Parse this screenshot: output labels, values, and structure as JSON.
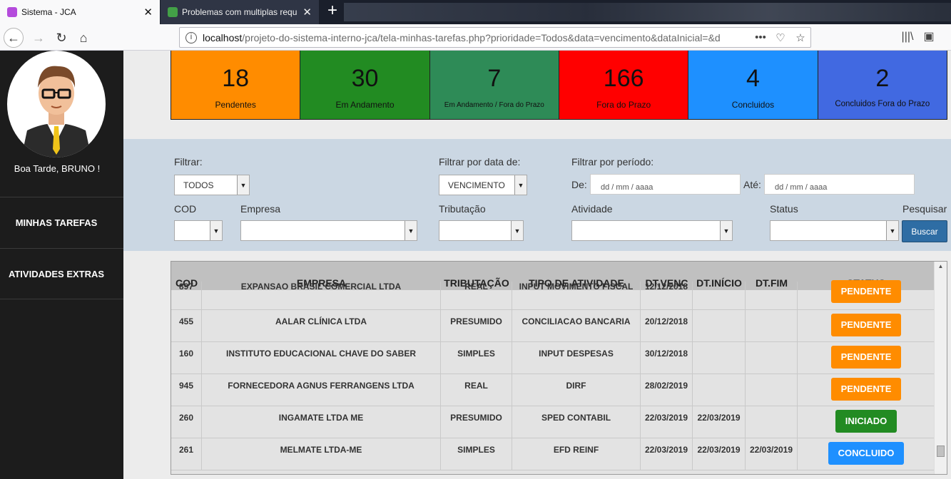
{
  "browser": {
    "tabs": [
      {
        "title": "Sistema - JCA",
        "favicon_color": "#b44bdc"
      },
      {
        "title": "Problemas com multiplas requ",
        "favicon_color": "#43a047"
      }
    ],
    "url_host": "localhost",
    "url_path": "/projeto-do-sistema-interno-jca/tela-minhas-tarefas.php?prioridade=Todos&data=vencimento&dataInicial=&d"
  },
  "sidebar": {
    "greeting": "Boa Tarde, BRUNO !",
    "items": [
      {
        "label": "MINHAS TAREFAS"
      },
      {
        "label": "ATIVIDADES EXTRAS"
      }
    ]
  },
  "stats": [
    {
      "value": "18",
      "label": "Pendentes",
      "color": "#ff8c00"
    },
    {
      "value": "30",
      "label": "Em Andamento",
      "color": "#228b22"
    },
    {
      "value": "7",
      "label": "Em Andamento / Fora do Prazo",
      "color": "#2e8b57"
    },
    {
      "value": "166",
      "label": "Fora do Prazo",
      "color": "#ff0000"
    },
    {
      "value": "4",
      "label": "Concluidos",
      "color": "#1e90ff"
    },
    {
      "value": "2",
      "label": "Concluidos Fora do Prazo",
      "color": "#4169e1"
    }
  ],
  "filters": {
    "filtrar_label": "Filtrar:",
    "filtrar_value": "TODOS",
    "data_label": "Filtrar por data de:",
    "data_value": "VENCIMENTO",
    "periodo_label": "Filtrar por período:",
    "de_label": "De:",
    "ate_label": "Até:",
    "date_placeholder": "dd / mm / aaaa",
    "cod_label": "COD",
    "empresa_label": "Empresa",
    "tributacao_label": "Tributação",
    "atividade_label": "Atividade",
    "status_label": "Status",
    "pesquisar_label": "Pesquisar",
    "buscar_button": "Buscar"
  },
  "table": {
    "headers": [
      "COD",
      "EMPRESA",
      "TRIBUTAÇÃO",
      "TIPO DE ATIVIDADE",
      "DT.VENC",
      "DT.INÍCIO",
      "DT.FIM",
      "STATUS"
    ],
    "rows": [
      {
        "cod": "897",
        "empresa": "EXPANSAO BRASIL COMERCIAL LTDA",
        "trib": "REAL",
        "tipo": "INPUT MOVIMENTO FISCAL",
        "venc": "12/12/2018",
        "inicio": "",
        "fim": "",
        "status": "PENDENTE",
        "status_color": "#ff8c00"
      },
      {
        "cod": "455",
        "empresa": "AALAR CLÍNICA LTDA",
        "trib": "PRESUMIDO",
        "tipo": "CONCILIACAO BANCARIA",
        "venc": "20/12/2018",
        "inicio": "",
        "fim": "",
        "status": "PENDENTE",
        "status_color": "#ff8c00"
      },
      {
        "cod": "160",
        "empresa": "INSTITUTO EDUCACIONAL CHAVE DO SABER",
        "trib": "SIMPLES",
        "tipo": "INPUT DESPESAS",
        "venc": "30/12/2018",
        "inicio": "",
        "fim": "",
        "status": "PENDENTE",
        "status_color": "#ff8c00"
      },
      {
        "cod": "945",
        "empresa": "FORNECEDORA AGNUS FERRANGENS LTDA",
        "trib": "REAL",
        "tipo": "DIRF",
        "venc": "28/02/2019",
        "inicio": "",
        "fim": "",
        "status": "PENDENTE",
        "status_color": "#ff8c00"
      },
      {
        "cod": "260",
        "empresa": "INGAMATE LTDA ME",
        "trib": "PRESUMIDO",
        "tipo": "SPED CONTABIL",
        "venc": "22/03/2019",
        "inicio": "22/03/2019",
        "fim": "",
        "status": "INICIADO",
        "status_color": "#228b22"
      },
      {
        "cod": "261",
        "empresa": "MELMATE LTDA-ME",
        "trib": "SIMPLES",
        "tipo": "EFD REINF",
        "venc": "22/03/2019",
        "inicio": "22/03/2019",
        "fim": "22/03/2019",
        "status": "CONCLUIDO",
        "status_color": "#1e90ff"
      }
    ]
  }
}
